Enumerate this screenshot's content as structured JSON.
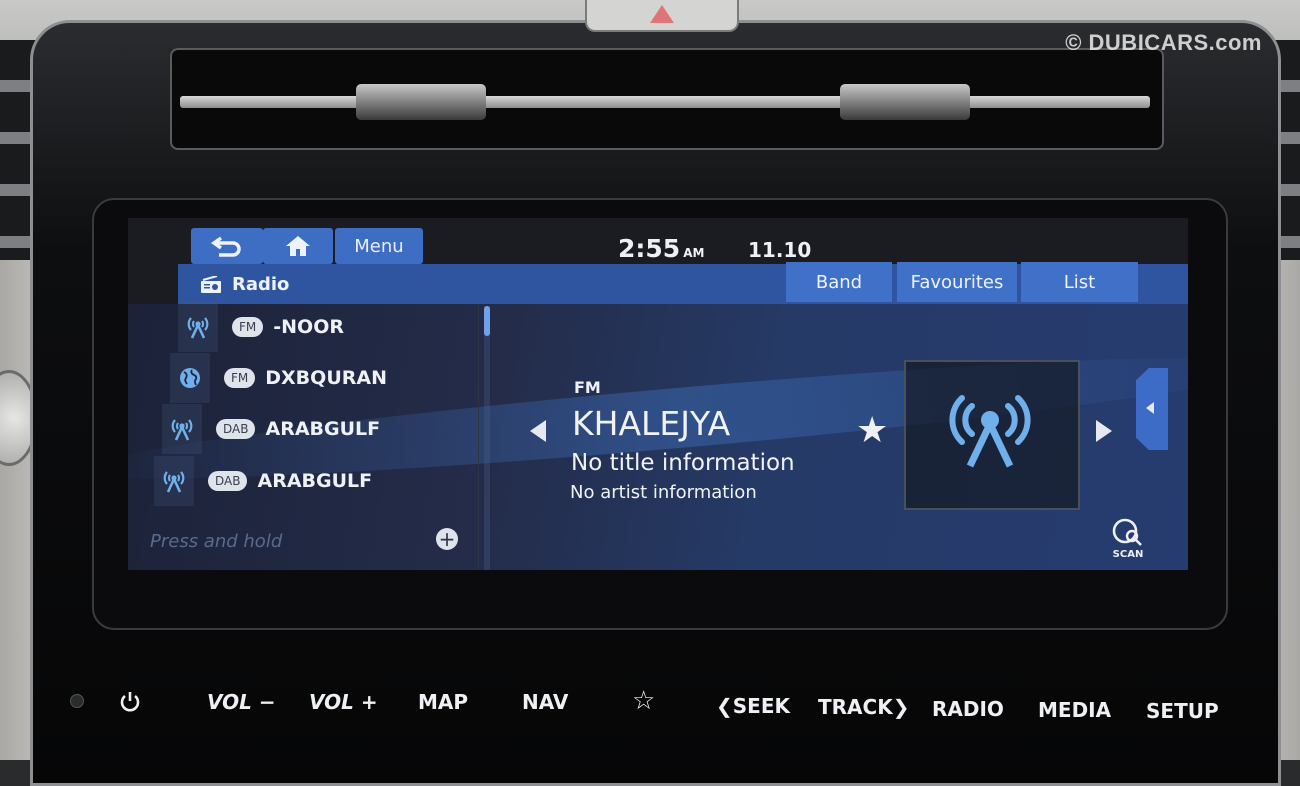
{
  "watermark": "© DUBICARS.com",
  "status": {
    "time": "2:55",
    "ampm": "AM",
    "date": "11.10"
  },
  "nav": {
    "back_icon": "back-arrow-icon",
    "home_icon": "home-icon",
    "menu_label": "Menu"
  },
  "header": {
    "title": "Radio",
    "title_icon": "radio-icon",
    "tabs": [
      {
        "label": "Band"
      },
      {
        "label": "Favourites"
      },
      {
        "label": "List"
      }
    ]
  },
  "stations": [
    {
      "source_icon": "antenna-icon",
      "band": "FM",
      "name": "-NOOR"
    },
    {
      "source_icon": "globe-icon",
      "band": "FM",
      "name": "DXBQURAN"
    },
    {
      "source_icon": "antenna-icon",
      "band": "DAB",
      "name": "ARABGULF"
    },
    {
      "source_icon": "antenna-icon",
      "band": "DAB",
      "name": "ARABGULF"
    }
  ],
  "list_footer": {
    "placeholder": "Press and hold",
    "add_icon": "plus-icon"
  },
  "now_playing": {
    "band": "FM",
    "station": "KHALEJYA",
    "title": "No title information",
    "artist": "No artist information",
    "scan_label": "SCAN"
  },
  "hardware_buttons": [
    {
      "label": "",
      "icon": "power-icon"
    },
    {
      "label": "VOL −"
    },
    {
      "label": "VOL +"
    },
    {
      "label": "MAP"
    },
    {
      "label": "NAV"
    },
    {
      "label": "☆",
      "icon": "star-icon"
    },
    {
      "label": "❮SEEK"
    },
    {
      "label": "TRACK❯"
    },
    {
      "label": "RADIO"
    },
    {
      "label": "MEDIA"
    },
    {
      "label": "SETUP"
    }
  ],
  "colors": {
    "accent": "#3d6ec3",
    "titlebar": "#2f55a0",
    "icon_blue": "#6fb0ea"
  }
}
